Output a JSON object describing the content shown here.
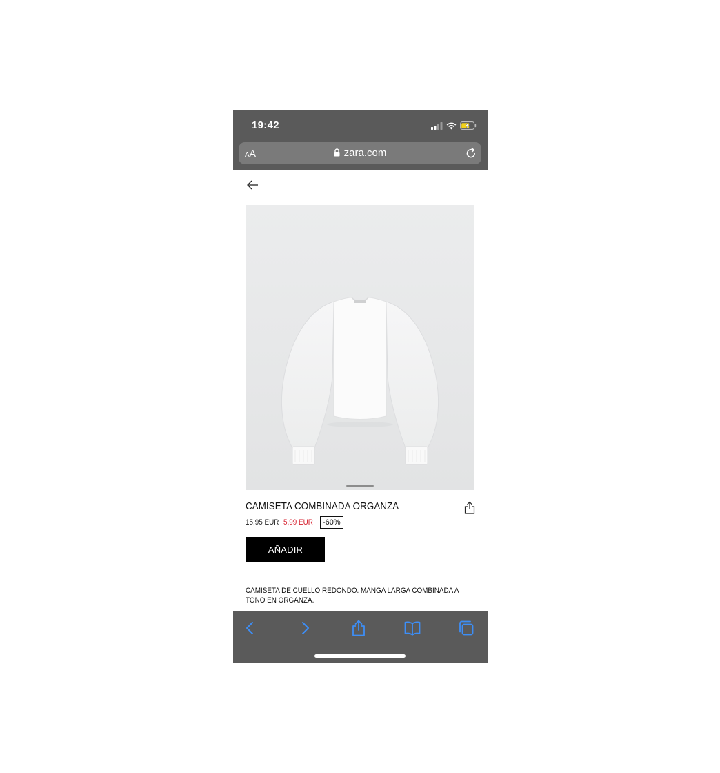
{
  "status_bar": {
    "time": "19:42",
    "icons": [
      "signal-icon",
      "wifi-icon",
      "battery-charging-icon"
    ],
    "battery_color": "#f2d21c"
  },
  "browser": {
    "text_size_label_small": "A",
    "text_size_label_large": "A",
    "url": "zara.com",
    "icons": [
      "lock-icon",
      "reload-icon"
    ],
    "toolbar_icons": [
      "back-icon",
      "forward-icon",
      "share-icon",
      "bookmarks-icon",
      "tabs-icon"
    ],
    "accent_color": "#3d8ef6"
  },
  "page": {
    "icons": [
      "arrow-left-icon",
      "share-icon"
    ],
    "product": {
      "title": "CAMISETA COMBINADA ORGANZA",
      "old_price": "15,95 EUR",
      "new_price": "5,99 EUR",
      "discount": "-60%",
      "add_label": "AÑADIR",
      "description": "CAMISETA DE CUELLO REDONDO. MANGA LARGA COMBINADA A TONO EN ORGANZA.",
      "sale_color": "#d6202e"
    }
  }
}
